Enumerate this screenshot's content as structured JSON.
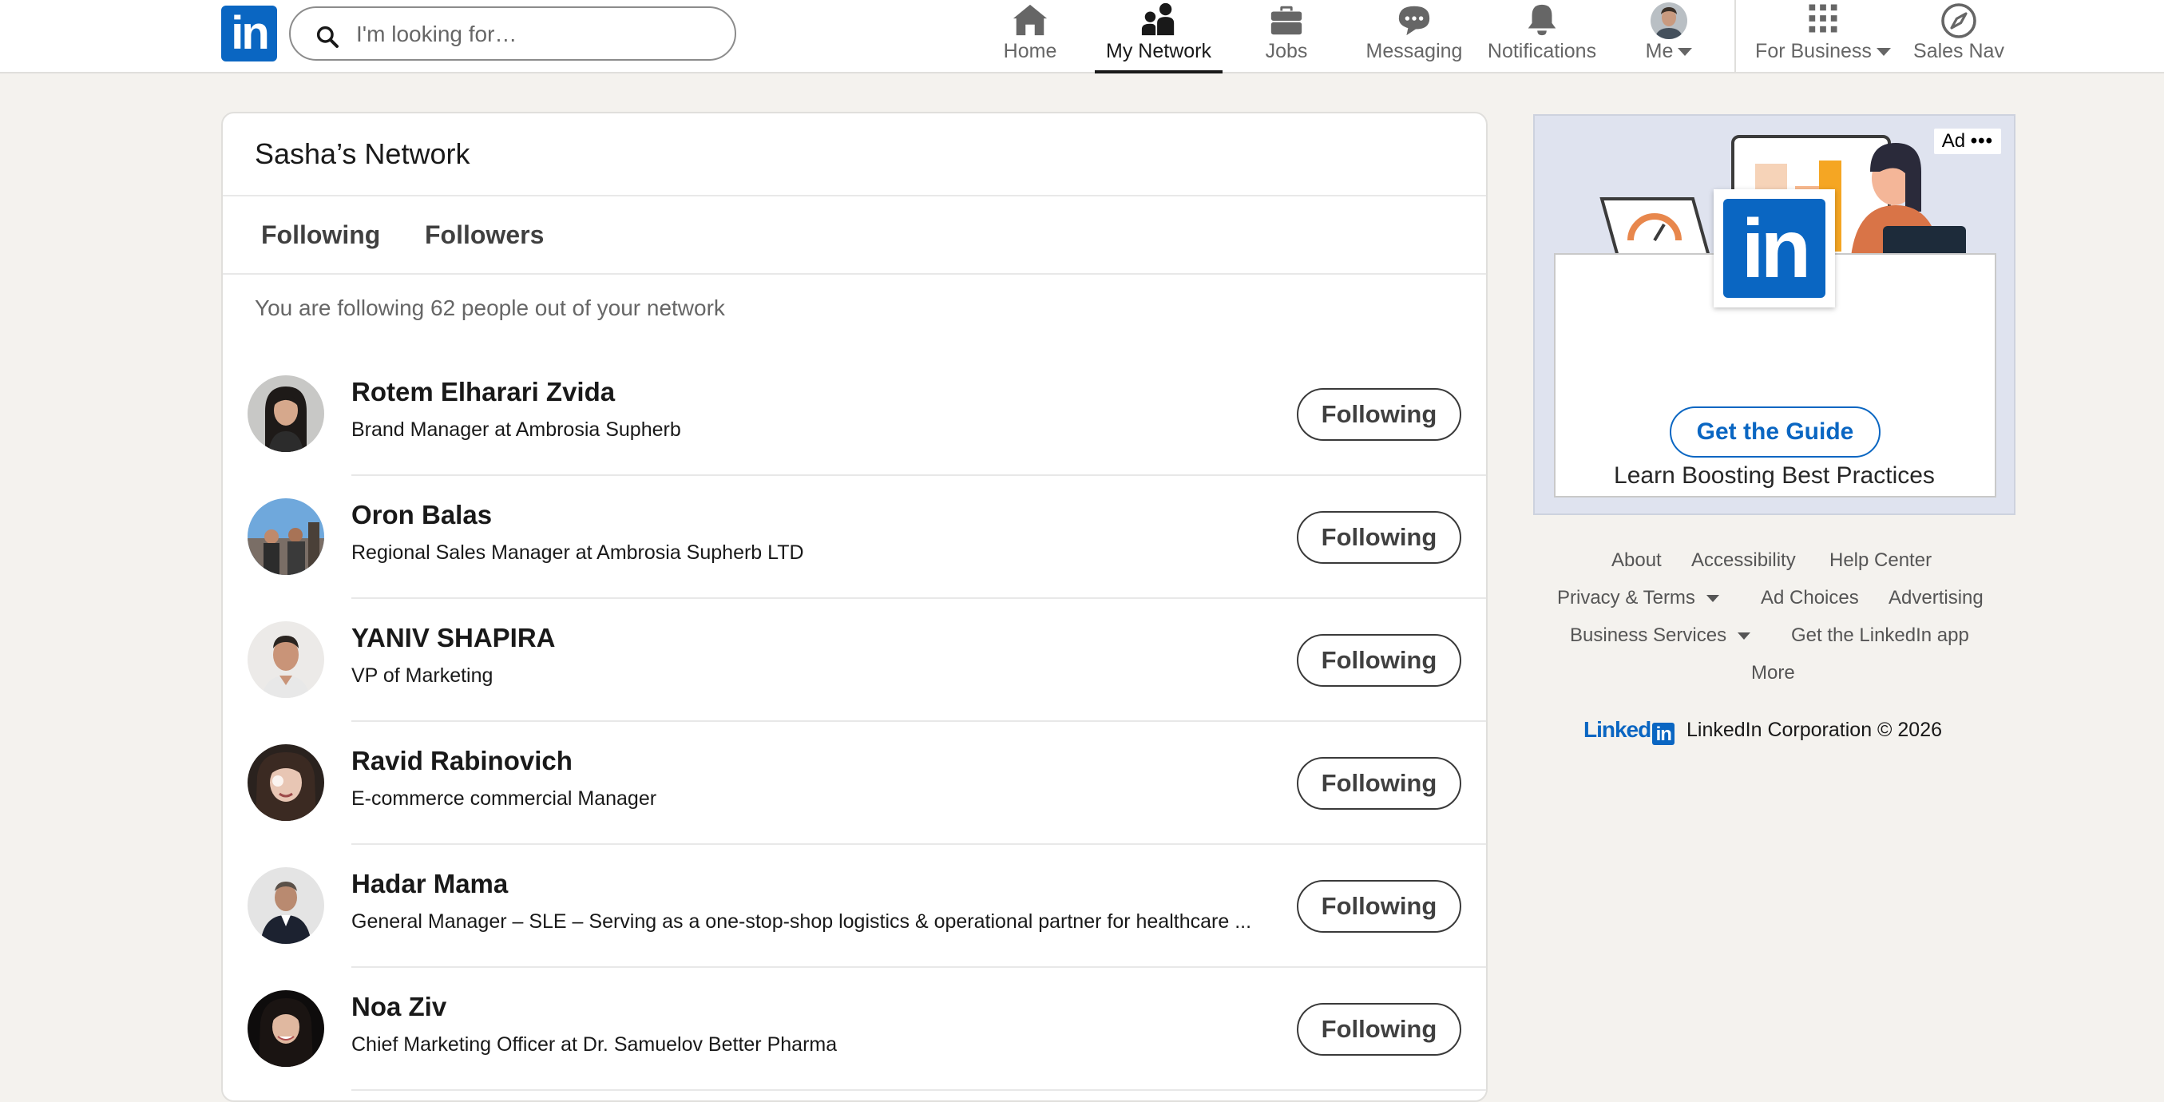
{
  "brand": {
    "logo_text": "in",
    "footer_wordmark": "Linked",
    "footer_in": "in",
    "color": "#0a66c2"
  },
  "search": {
    "placeholder": "I'm looking for…"
  },
  "nav": {
    "items": [
      {
        "label": "Home",
        "icon": "home-icon"
      },
      {
        "label": "My Network",
        "icon": "my-network-icon",
        "active": true
      },
      {
        "label": "Jobs",
        "icon": "briefcase-icon"
      },
      {
        "label": "Messaging",
        "icon": "message-icon"
      },
      {
        "label": "Notifications",
        "icon": "bell-icon"
      },
      {
        "label": "Me",
        "icon": "avatar"
      },
      {
        "label": "For Business",
        "icon": "grid-icon"
      },
      {
        "label": "Sales Nav",
        "icon": "compass-icon"
      }
    ]
  },
  "network": {
    "title": "Sasha’s Network",
    "tabs": [
      "Following",
      "Followers"
    ],
    "summary": "You are following 62 people out of your network",
    "button_label": "Following",
    "people": [
      {
        "name": "Rotem Elharari Zvida",
        "headline": "Brand Manager at Ambrosia Supherb"
      },
      {
        "name": "Oron Balas",
        "headline": "Regional Sales Manager at Ambrosia Supherb LTD"
      },
      {
        "name": "YANIV SHAPIRA",
        "headline": "VP of Marketing"
      },
      {
        "name": "Ravid Rabinovich",
        "headline": "E-commerce commercial Manager"
      },
      {
        "name": "Hadar Mama",
        "headline": "General Manager – SLE – Serving as a one-stop-shop logistics & operational partner for healthcare ..."
      },
      {
        "name": "Noa Ziv",
        "headline": "Chief Marketing Officer at Dr. Samuelov Better Pharma"
      }
    ]
  },
  "ad": {
    "badge": "Ad",
    "headline": "Learn Boosting Best Practices",
    "cta": "Get the Guide",
    "logo_text": "in"
  },
  "footer": {
    "about": "About",
    "accessibility": "Accessibility",
    "help": "Help Center",
    "privacy": "Privacy & Terms",
    "ad_choices": "Ad Choices",
    "advertising": "Advertising",
    "business": "Business Services",
    "app": "Get the LinkedIn app",
    "more": "More",
    "copyright": "LinkedIn Corporation © 2026"
  }
}
